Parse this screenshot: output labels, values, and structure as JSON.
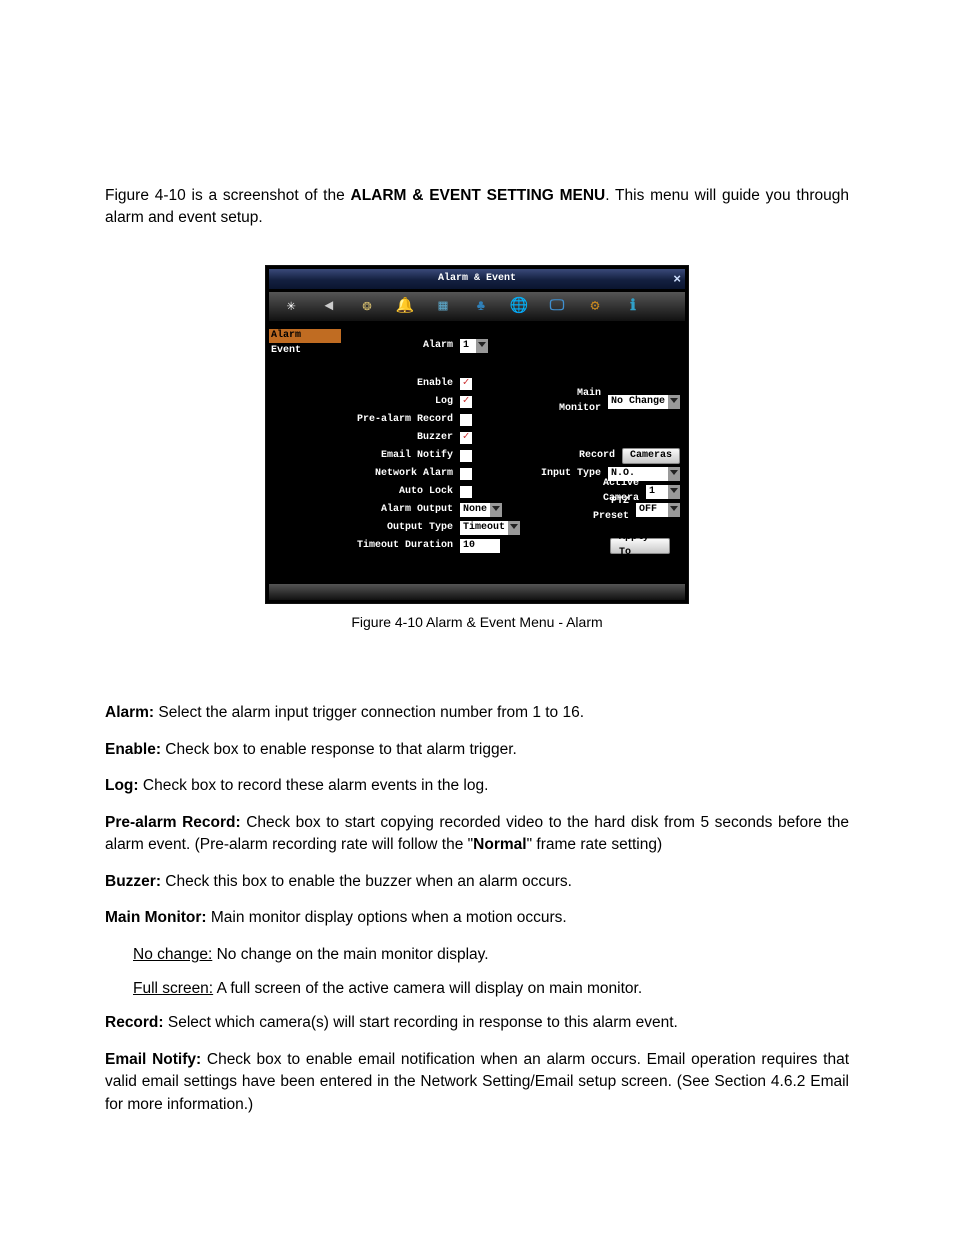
{
  "intro": {
    "prefix": "Figure 4-10 is a screenshot of the ",
    "bold": "ALARM & EVENT SETTING MENU",
    "suffix": ". This menu will guide you through alarm and event setup."
  },
  "dialog": {
    "title": "Alarm & Event",
    "close": "×",
    "toolbar_icons": [
      "motion-icon",
      "camera-icon",
      "search-icon",
      "bell-icon",
      "clock-icon",
      "network-icon",
      "web-icon",
      "monitor-icon",
      "gear-icon",
      "info-icon"
    ],
    "sidebar": {
      "items": [
        "Alarm",
        "Event"
      ],
      "selected": 0
    },
    "fields": {
      "alarm_label": "Alarm",
      "alarm_value": "1",
      "enable_label": "Enable",
      "enable_checked": true,
      "log_label": "Log",
      "log_checked": true,
      "main_monitor_label": "Main Monitor",
      "main_monitor_value": "No Change",
      "prealarm_label": "Pre-alarm Record",
      "prealarm_checked": false,
      "buzzer_label": "Buzzer",
      "buzzer_checked": true,
      "email_label": "Email Notify",
      "email_checked": false,
      "record_label": "Record",
      "record_btn": "Cameras",
      "network_label": "Network Alarm",
      "network_checked": false,
      "inputtype_label": "Input Type",
      "inputtype_value": "N.O.",
      "autolock_label": "Auto Lock",
      "autolock_checked": false,
      "activecam_label": "Active Camera",
      "activecam_value": "1",
      "alarmout_label": "Alarm Output",
      "alarmout_value": "None",
      "ptz_label": "PTZ Preset",
      "ptz_value": "OFF",
      "outtype_label": "Output Type",
      "outtype_value": "Timeout",
      "timeout_label": "Timeout Duration",
      "timeout_value": "10",
      "apply_btn": "Apply To"
    }
  },
  "caption": "Figure 4-10 Alarm & Event Menu - Alarm",
  "descriptions": {
    "alarm": {
      "term": "Alarm:",
      "text": " Select the alarm input trigger connection number from 1 to 16."
    },
    "enable": {
      "term": "Enable:",
      "text": " Check box to enable response to that alarm trigger."
    },
    "log": {
      "term": "Log:",
      "text": " Check box to record these alarm events in the log."
    },
    "prealarm": {
      "term": "Pre-alarm Record:",
      "pre": " Check box to start copying recorded video to the hard disk from 5 seconds before the alarm event. (Pre-alarm recording rate will follow the \"",
      "bold": "Normal",
      "post": "\" frame rate setting)"
    },
    "buzzer": {
      "term": "Buzzer:",
      "text": " Check this box to enable the buzzer when an alarm occurs."
    },
    "mainmon": {
      "term": "Main Monitor:",
      "text": " Main monitor display options when a motion occurs."
    },
    "nochange": {
      "ul": "No change:",
      "text": " No change on the main monitor display."
    },
    "fullscreen": {
      "ul": "Full screen:",
      "text": " A full screen of the active camera will display on main monitor."
    },
    "record": {
      "term": "Record:",
      "text": " Select which camera(s) will start recording in response to this alarm event."
    },
    "email": {
      "term": "Email Notify:",
      "text": " Check box to enable email notification when an alarm occurs. Email operation requires that valid email settings have been entered in the Network Setting/Email setup screen. (See Section 4.6.2 Email for more information.)"
    }
  }
}
